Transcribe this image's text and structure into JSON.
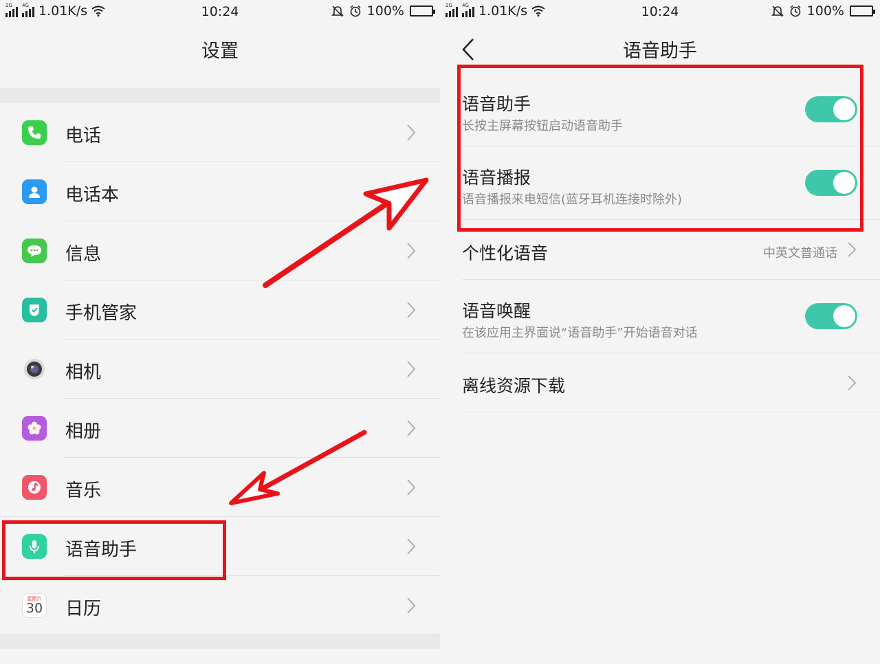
{
  "status_bar": {
    "net_2g": "2G",
    "net_4g": "4G",
    "speed": "1.01K/s",
    "time": "10:24",
    "battery": "100%",
    "battery_level": 1.0
  },
  "left_screen": {
    "title": "设置",
    "items": [
      {
        "label": "电话",
        "icon": "phone-icon",
        "color": "#3ccf4e"
      },
      {
        "label": "电话本",
        "icon": "contacts-icon",
        "color": "#2b9af3"
      },
      {
        "label": "信息",
        "icon": "message-icon",
        "color": "#46c84f"
      },
      {
        "label": "手机管家",
        "icon": "phone-manager-icon",
        "color": "#28bfa0"
      },
      {
        "label": "相机",
        "icon": "camera-icon",
        "color": "#5a5a5a"
      },
      {
        "label": "相册",
        "icon": "gallery-icon",
        "color": "#b55ddc"
      },
      {
        "label": "音乐",
        "icon": "music-icon",
        "color": "#f0566a"
      },
      {
        "label": "语音助手",
        "icon": "microphone-icon",
        "color": "#30d3a0"
      },
      {
        "label": "日历",
        "icon": "calendar-icon",
        "color": "#ffffff"
      }
    ],
    "calendar_weekday": "星期六",
    "calendar_day": "30"
  },
  "right_screen": {
    "title": "语音助手",
    "items": [
      {
        "title": "语音助手",
        "subtitle": "长按主屏幕按钮启动语音助手",
        "toggle": true
      },
      {
        "title": "语音播报",
        "subtitle": "语音播报来电短信(蓝牙耳机连接时除外)",
        "toggle": true
      },
      {
        "title": "个性化语音",
        "value": "中英文普通话"
      },
      {
        "title": "语音唤醒",
        "subtitle": "在该应用主界面说“语音助手”开始语音对话",
        "toggle": true
      },
      {
        "title": "离线资源下载"
      }
    ]
  },
  "colors": {
    "toggle_on": "#3ec8a9",
    "highlight": "#e8141a",
    "background": "#f4f4f4"
  }
}
